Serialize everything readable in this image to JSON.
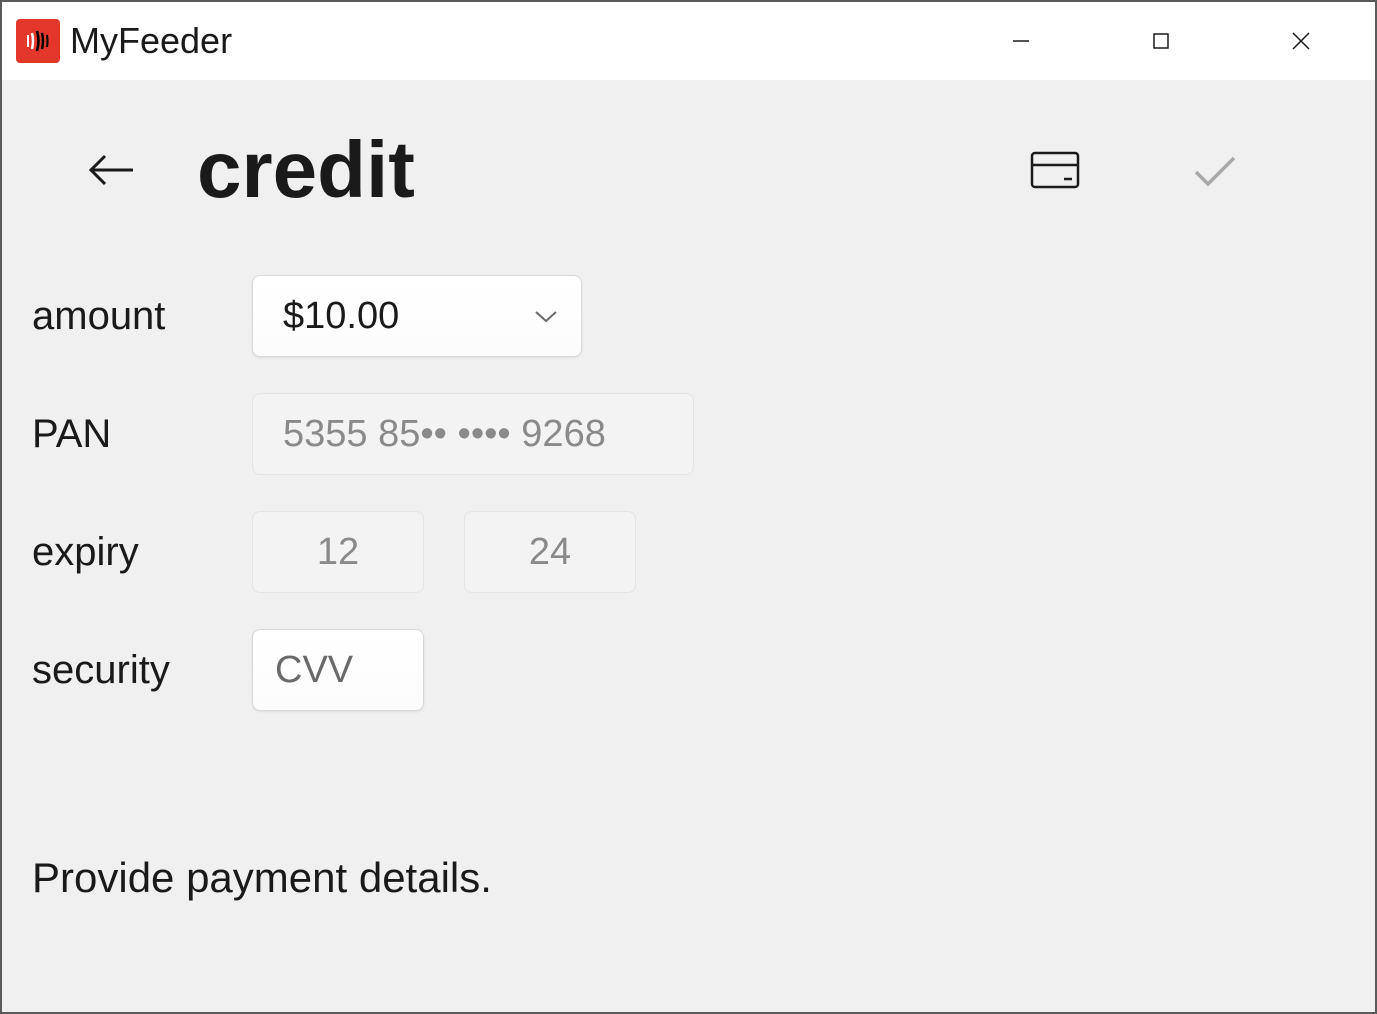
{
  "window": {
    "app_name": "MyFeeder"
  },
  "header": {
    "title": "credit"
  },
  "form": {
    "amount_label": "amount",
    "amount_value": "$10.00",
    "pan_label": "PAN",
    "pan_placeholder": "5355 85•• •••• 9268",
    "pan_value": "",
    "expiry_label": "expiry",
    "expiry_month_placeholder": "12",
    "expiry_month_value": "",
    "expiry_year_placeholder": "24",
    "expiry_year_value": "",
    "security_label": "security",
    "cvv_placeholder": "CVV",
    "cvv_value": ""
  },
  "status": {
    "message": "Provide payment details."
  }
}
